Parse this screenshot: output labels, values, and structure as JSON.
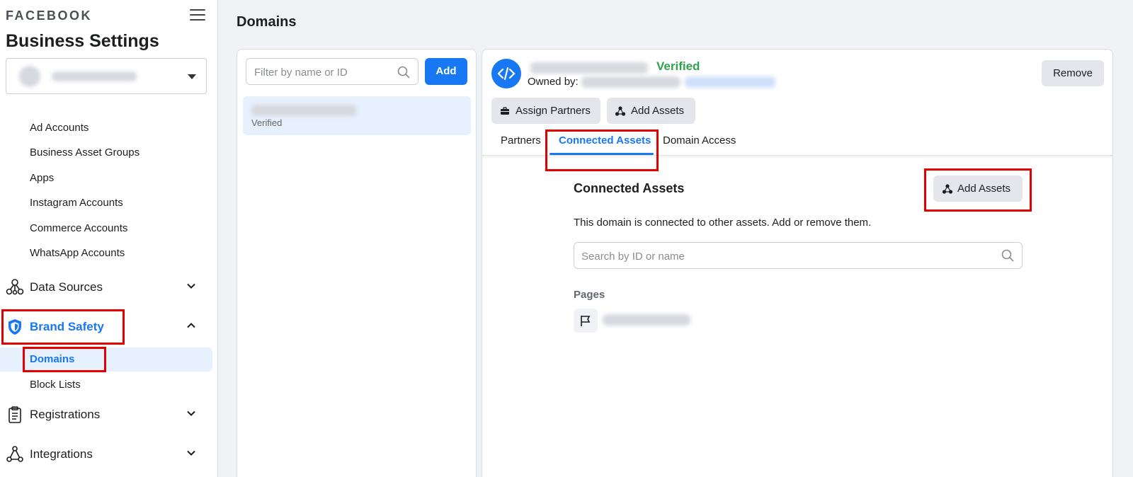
{
  "sidebar": {
    "brand": "FACEBOOK",
    "title": "Business Settings",
    "account_items": [
      "Ad Accounts",
      "Business Asset Groups",
      "Apps",
      "Instagram Accounts",
      "Commerce Accounts",
      "WhatsApp Accounts"
    ],
    "data_sources": "Data Sources",
    "brand_safety": "Brand Safety",
    "domains": "Domains",
    "block_lists": "Block Lists",
    "registrations": "Registrations",
    "integrations": "Integrations"
  },
  "main": {
    "title": "Domains",
    "filter_placeholder": "Filter by name or ID",
    "add_label": "Add",
    "domain_status": "Verified"
  },
  "detail": {
    "verified": "Verified",
    "owned_by": "Owned by:",
    "remove": "Remove",
    "assign_partners": "Assign Partners",
    "add_assets": "Add Assets",
    "tabs": [
      "Partners",
      "Connected Assets",
      "Domain Access"
    ],
    "section_title": "Connected Assets",
    "section_add_assets": "Add Assets",
    "description": "This domain is connected to other assets. Add or remove them.",
    "search_placeholder": "Search by ID or name",
    "pages_label": "Pages"
  },
  "colors": {
    "accent": "#1877f2",
    "verified": "#31a24c",
    "highlight": "#e00000"
  }
}
